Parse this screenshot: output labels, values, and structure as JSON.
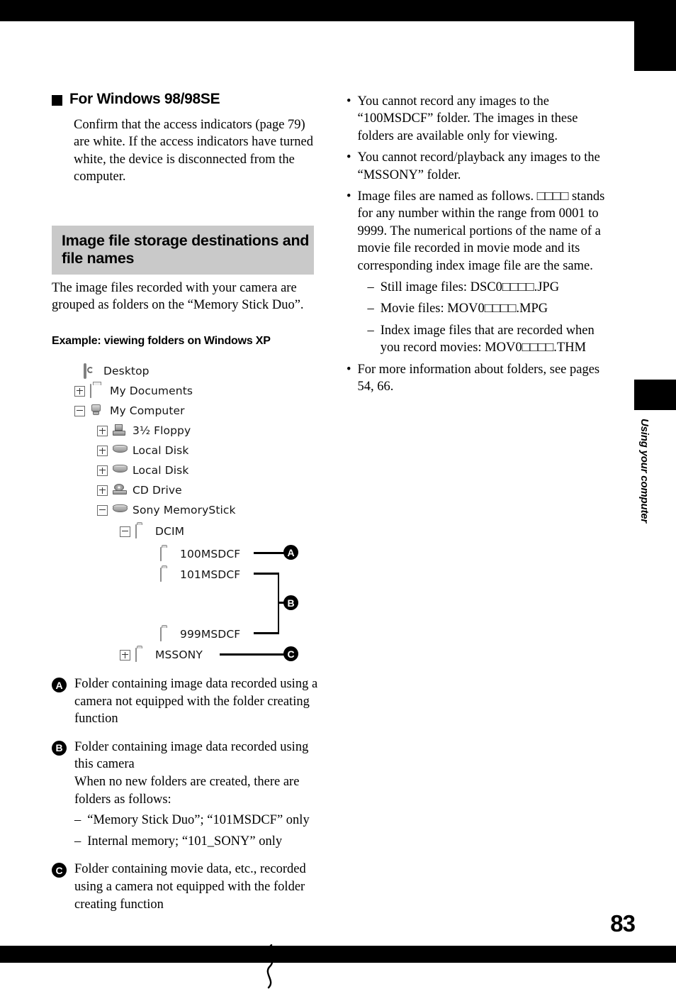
{
  "page": {
    "number": "83",
    "side_tab_label": "Using your computer"
  },
  "left": {
    "section_heading": "For Windows 98/98SE",
    "section_body": "Confirm that the access indicators (page 79) are white. If the access indicators have turned white, the device is disconnected from the computer.",
    "band_title": "Image file storage destinations and file names",
    "intro_paragraph": "The image files recorded with your camera are grouped as folders on the “Memory Stick Duo”.",
    "example_heading": "Example: viewing folders on Windows XP"
  },
  "tree": {
    "nodes": [
      {
        "label": "Desktop",
        "icon": "desktop-icon",
        "expander": "none"
      },
      {
        "label": "My Documents",
        "icon": "documents-icon",
        "expander": "plus"
      },
      {
        "label": "My Computer",
        "icon": "computer-icon",
        "expander": "minus"
      },
      {
        "label": "3½ Floppy",
        "icon": "floppy-icon",
        "expander": "plus"
      },
      {
        "label": "Local Disk",
        "icon": "disk-icon",
        "expander": "plus"
      },
      {
        "label": "Local Disk",
        "icon": "disk-icon",
        "expander": "plus"
      },
      {
        "label": "CD Drive",
        "icon": "cd-icon",
        "expander": "plus"
      },
      {
        "label": "Sony MemoryStick",
        "icon": "disk-icon",
        "expander": "minus"
      },
      {
        "label": "DCIM",
        "icon": "folder-icon",
        "expander": "minus"
      },
      {
        "label": "100MSDCF",
        "icon": "folder-icon",
        "expander": "none"
      },
      {
        "label": "101MSDCF",
        "icon": "folder-icon",
        "expander": "none"
      },
      {
        "label": "999MSDCF",
        "icon": "folder-icon",
        "expander": "none"
      },
      {
        "label": "MSSONY",
        "icon": "folder-icon",
        "expander": "plus"
      }
    ],
    "callouts": {
      "a": "A",
      "b": "B",
      "c": "C"
    }
  },
  "legend": {
    "a": {
      "badge": "A",
      "text": "Folder containing image data recorded using a camera not equipped with the folder creating function"
    },
    "b": {
      "badge": "B",
      "text": "Folder containing image data recorded using this camera",
      "text2": "When no new folders are created, there are folders as follows:",
      "items": [
        "“Memory Stick Duo”; “101MSDCF” only",
        "Internal memory; “101_SONY” only"
      ]
    },
    "c": {
      "badge": "C",
      "text": "Folder containing movie data, etc., recorded using a camera not equipped with the folder creating function"
    }
  },
  "right": {
    "bullets": [
      {
        "text": "You cannot record any images to the “100MSDCF” folder. The images in these folders are available only for viewing."
      },
      {
        "text": "You cannot record/playback any images to the “MSSONY” folder."
      },
      {
        "text": "Image files are named as follows. □□□□ stands for any number within the range from 0001 to 9999. The numerical portions of the name of a movie file recorded in movie mode and its corresponding index image file are the same.",
        "sub": [
          "Still image files: DSC0□□□□.JPG",
          "Movie files: MOV0□□□□.MPG",
          "Index image files that are recorded when you record movies: MOV0□□□□.THM"
        ]
      },
      {
        "text": "For more information about folders, see pages 54, 66."
      }
    ],
    "bullet_glyph": "•",
    "dash_glyph": "–"
  }
}
